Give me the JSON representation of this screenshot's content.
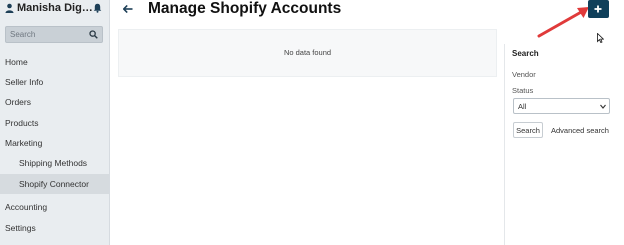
{
  "sidebar": {
    "user_name": "Manisha Dig…",
    "search": {
      "placeholder": "Search"
    },
    "items": [
      {
        "label": "Home"
      },
      {
        "label": "Seller Info"
      },
      {
        "label": "Orders"
      },
      {
        "label": "Products"
      },
      {
        "label": "Marketing"
      },
      {
        "label": "Shipping Methods"
      },
      {
        "label": "Shopify Connector",
        "active": true
      },
      {
        "label": "Accounting"
      },
      {
        "label": "Settings"
      }
    ]
  },
  "header": {
    "title": "Manage Shopify Accounts",
    "add_icon": "plus-icon",
    "back_icon": "arrow-left-icon"
  },
  "main": {
    "empty_message": "No data found"
  },
  "search_panel": {
    "title": "Search",
    "vendor_label": "Vendor",
    "status_label": "Status",
    "status_value": "All",
    "search_button": "Search",
    "advanced_link": "Advanced search"
  },
  "colors": {
    "accent": "#0f3f5a",
    "sidebar_bg": "#e9edf0",
    "annotation_arrow": "#e03a3a"
  }
}
